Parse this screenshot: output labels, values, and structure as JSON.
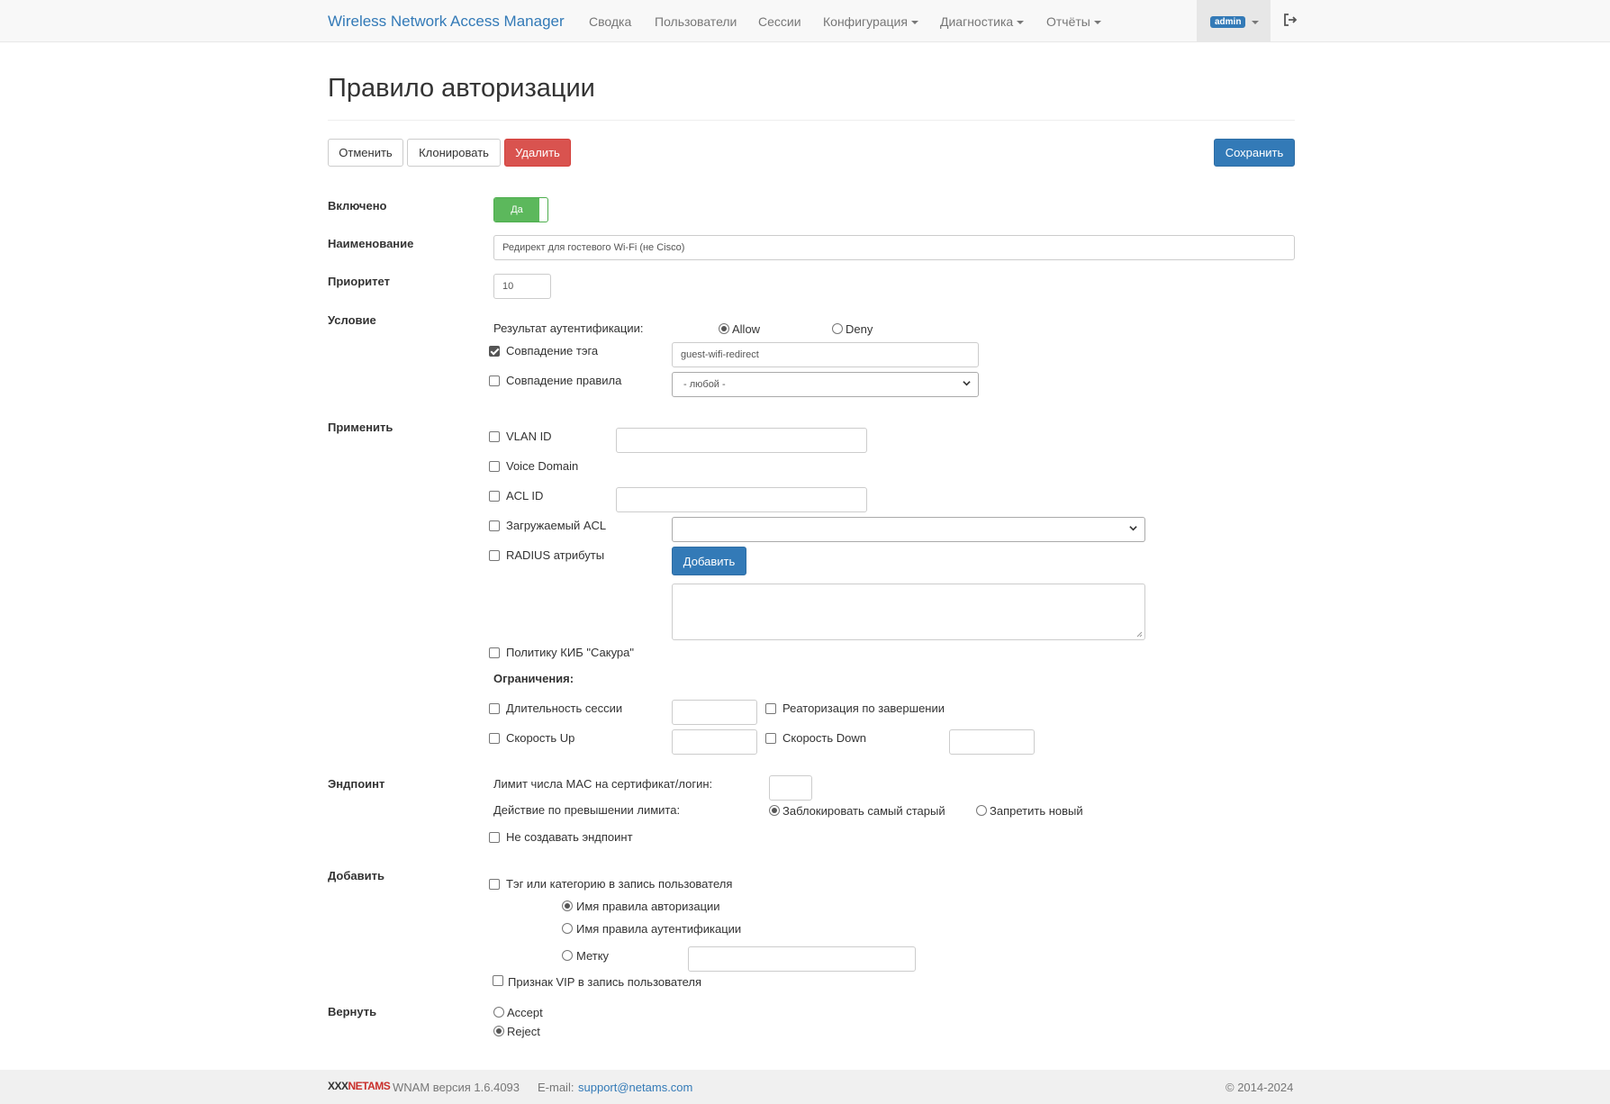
{
  "navbar": {
    "brand": "Wireless Network Access Manager",
    "items": [
      {
        "label": "Сводка"
      },
      {
        "label": "Пользователи"
      },
      {
        "label": "Сессии"
      },
      {
        "label": "Конфигурация"
      },
      {
        "label": "Диагностика"
      },
      {
        "label": "Отчёты"
      }
    ],
    "user": "admin"
  },
  "page": {
    "title": "Правило авторизации"
  },
  "toolbar": {
    "cancel_label": "Отменить",
    "clone_label": "Клонировать",
    "delete_label": "Удалить",
    "save_label": "Сохранить"
  },
  "form": {
    "enabled": {
      "label": "Включено",
      "switch_label": "Да",
      "value": true
    },
    "name": {
      "label": "Наименование",
      "value": "Редирект для гостевого Wi-Fi (не Cisco)"
    },
    "priority": {
      "label": "Приоритет",
      "value": "10"
    },
    "condition": {
      "label": "Условие",
      "auth_result_label": "Результат аутентификации:",
      "allow_label": "Allow",
      "deny_label": "Deny",
      "auth_result": "Allow",
      "tag_match_label": "Совпадение тэга",
      "tag_match_checked": true,
      "tag_value": "guest-wifi-redirect",
      "rule_match_label": "Совпадение правила",
      "rule_match_checked": false,
      "rule_select_value": "- любой -"
    },
    "apply": {
      "label": "Применить",
      "vlan_label": "VLAN ID",
      "vlan_value": "",
      "voice_domain_label": "Voice Domain",
      "acl_label": "ACL ID",
      "acl_value": "",
      "dacl_label": "Загружаемый ACL",
      "dacl_value": "",
      "radius_label": "RADIUS атрибуты",
      "add_label": "Добавить",
      "kib_label": "Политику КИБ \"Сакура\"",
      "limits_label": "Ограничения:",
      "session_duration_label": "Длительность сессии",
      "reauth_label": "Реаторизация по завершении",
      "speed_up_label": "Скорость Up",
      "speed_down_label": "Скорость Down"
    },
    "endpoint": {
      "label": "Эндпоинт",
      "mac_limit_label": "Лимит числа MAC на сертификат/логин:",
      "mac_limit_value": "",
      "overflow_label": "Действие по превышении лимита:",
      "block_oldest_label": "Заблокировать самый старый",
      "deny_new_label": "Запретить новый",
      "overflow_action": "block_oldest",
      "no_create_label": "Не создавать эндпоинт"
    },
    "add": {
      "label": "Добавить",
      "tag_category_label": "Тэг или категорию в запись пользователя",
      "authz_rule_name_label": "Имя правила авторизации",
      "authn_rule_name_label": "Имя правила аутентификации",
      "mark_label": "Метку",
      "mark_value": "",
      "selected": "authz_rule_name",
      "vip_label": "Признак VIP в запись пользователя"
    },
    "return": {
      "label": "Вернуть",
      "accept_label": "Accept",
      "reject_label": "Reject",
      "value": "Reject"
    }
  },
  "footer": {
    "logo_x": "XXX",
    "logo": "NETAMS",
    "version": "WNAM версия 1.6.4093",
    "email_label": "E-mail:",
    "email": "support@netams.com",
    "copyright": "© 2014-2024"
  }
}
